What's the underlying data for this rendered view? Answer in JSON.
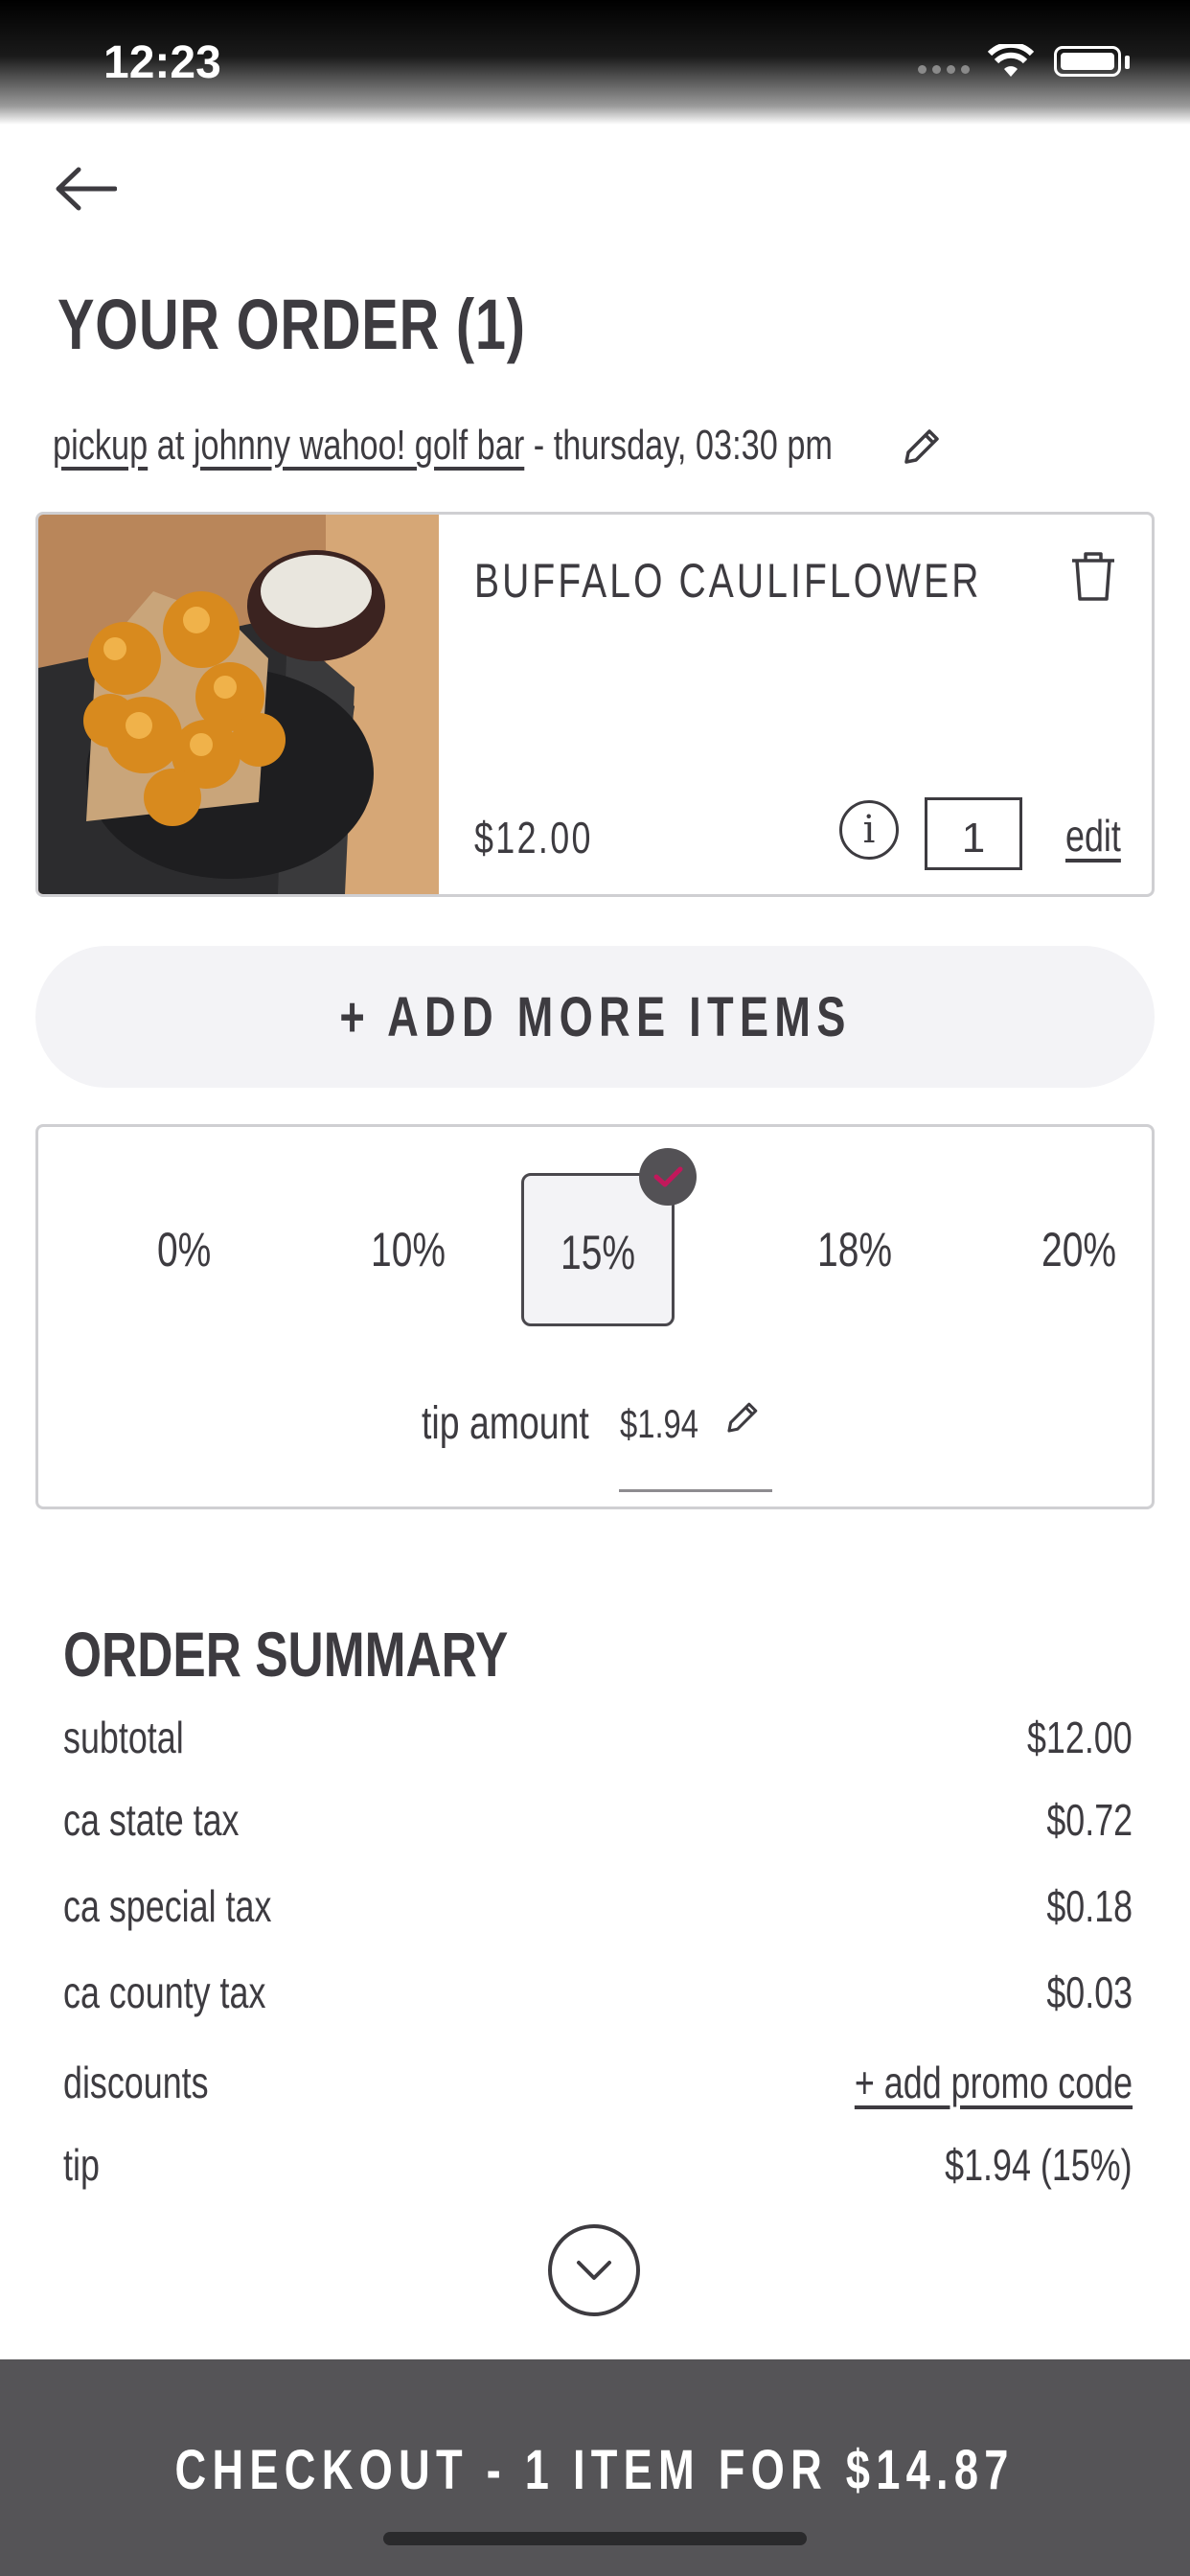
{
  "status_bar": {
    "time": "12:23"
  },
  "header": {
    "title": "YOUR ORDER (1)"
  },
  "pickup": {
    "mode": "pickup",
    "at": "at",
    "location": "johnny wahoo! golf bar",
    "when": "- thursday, 03:30 pm"
  },
  "item": {
    "name": "BUFFALO CAULIFLOWER",
    "price": "$12.00",
    "info": "i",
    "quantity": "1",
    "edit_label": "edit"
  },
  "add_more": {
    "label": "+ ADD MORE ITEMS"
  },
  "tip": {
    "options": [
      "0%",
      "10%",
      "15%",
      "18%",
      "20%"
    ],
    "selected": "15%",
    "amount_label": "tip amount",
    "amount": "$1.94"
  },
  "summary": {
    "title": "ORDER SUMMARY",
    "rows": [
      {
        "label": "subtotal",
        "value": "$12.00"
      },
      {
        "label": "ca state tax",
        "value": "$0.72"
      },
      {
        "label": "ca special tax",
        "value": "$0.18"
      },
      {
        "label": "ca county tax",
        "value": "$0.03"
      },
      {
        "label": "discounts",
        "value": "+ add promo code"
      },
      {
        "label": "tip",
        "value": "$1.94 (15%)"
      }
    ]
  },
  "checkout": {
    "label": "CHECKOUT - 1 ITEM FOR $14.87"
  },
  "colors": {
    "text": "#3d3b40",
    "accent": "#c2185b",
    "checkout_bg": "#555457",
    "pill_bg": "#f3f3f6"
  }
}
